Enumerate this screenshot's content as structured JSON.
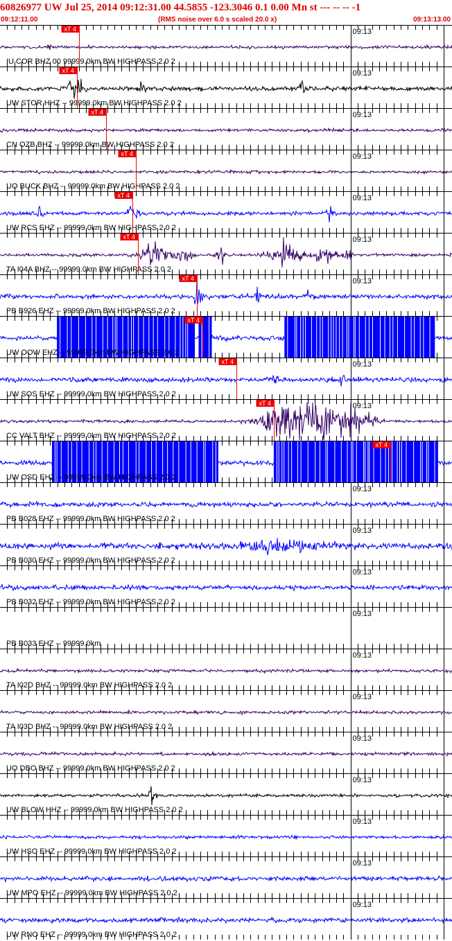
{
  "header": {
    "title": "60826977 UW Jul 25, 2014 09:12:31.00   44.5855 -123.3046  0.1 0.00 Mn st --- -- --  -1",
    "start_time": "09:12:11.00",
    "subtitle": "(RMS noise over 6.0 s scaled 20.0 x)",
    "end_time": "09:13:13.00"
  },
  "chart_data": {
    "type": "line",
    "x_range_seconds": [
      0,
      62
    ],
    "minute_tick_seconds": 49,
    "minute_tick_label": "09:13",
    "pick_label": "xT 4",
    "colors": {
      "pick": "#ee0000",
      "grid": "#000000",
      "blue": "#0000ff",
      "purple": "#330066",
      "black": "#000000"
    },
    "traces": [
      {
        "label": "IU COR BHZ 00 99999.0km BW  HIGHPASS  2.0  2",
        "color": "#330066",
        "pick_s": 11.0,
        "amp": 2,
        "events": [
          [
            6.9,
            0.2,
            5
          ]
        ]
      },
      {
        "label": "UW STOR HHZ -- 99999.0km BW  HIGHPASS  2.0  2",
        "color": "#000000",
        "pick_s": 10.8,
        "amp": 3,
        "events": [
          [
            6.8,
            0.15,
            8
          ],
          [
            10.3,
            0.4,
            14
          ],
          [
            11.3,
            0.5,
            11
          ],
          [
            19.8,
            0.3,
            7
          ],
          [
            42.0,
            0.35,
            13
          ]
        ]
      },
      {
        "label": "CN OZB BHZ -- 99999.0km BW  HIGHPASS  2.0  2",
        "color": "#330066",
        "pick_s": 14.8,
        "amp": 2,
        "events": []
      },
      {
        "label": "UO BUCK BHZ -- 99999.0km BW  HIGHPASS  2.0  2",
        "color": "#330066",
        "pick_s": 19.0,
        "amp": 2,
        "events": []
      },
      {
        "label": "UW RCS EHZ -- 99999.0km BW  HIGHPASS  2.0  2",
        "color": "#0000ff",
        "pick_s": 18.5,
        "amp": 2.5,
        "events": [
          [
            5.6,
            0.3,
            9
          ],
          [
            18.6,
            0.4,
            14
          ],
          [
            46.0,
            0.25,
            24
          ]
        ]
      },
      {
        "label": "TA I04A BHZ -- 99999.0km BW  HIGHPASS  2.0  2",
        "color": "#330066",
        "pick_s": 19.3,
        "amp": 2,
        "events": [
          [
            21.5,
            1.3,
            14
          ],
          [
            25.8,
            0.9,
            9
          ],
          [
            31.0,
            0.5,
            9
          ],
          [
            39.8,
            1.5,
            15
          ],
          [
            45.5,
            1.0,
            11
          ],
          [
            48.8,
            0.5,
            8
          ]
        ]
      },
      {
        "label": "PB B926 EHZ -- 99999.0km BW  HIGHPASS  2.0  2",
        "color": "#0000ff",
        "pick_s": 27.5,
        "amp": 3,
        "events": [
          [
            27.6,
            0.3,
            30
          ],
          [
            36.0,
            0.15,
            10
          ],
          [
            43.0,
            0.15,
            10
          ]
        ]
      },
      {
        "label": "UW OOW EHZ -- 99999.0km BW  HIGHPASS  2.0  2",
        "color": "#0000ff",
        "pick_s": 28.3,
        "amp": 3,
        "events": [],
        "saturated": [
          [
            8.0,
            27.2
          ],
          [
            27.8,
            29.6
          ],
          [
            39.8,
            60.8
          ]
        ]
      },
      {
        "label": "UW SOS EHZ -- 99999.0km BW  HIGHPASS  2.0  2",
        "color": "#0000ff",
        "pick_s": 33.0,
        "amp": 3,
        "events": [
          [
            38.5,
            0.6,
            6
          ],
          [
            48.0,
            0.6,
            6
          ]
        ]
      },
      {
        "label": "CC VALT BHZ -- 99999.0km BW  HIGHPASS  2.0  2",
        "color": "#330066",
        "pick_s": 38.3,
        "amp": 2,
        "events": [
          [
            38.0,
            1.2,
            13
          ],
          [
            43.0,
            3.0,
            30
          ],
          [
            49.0,
            2.0,
            17
          ]
        ]
      },
      {
        "label": "UW OSD EHZ -- 99999.0km BW  HIGHPASS  2.0  2",
        "color": "#0000ff",
        "pick_s": 54.5,
        "amp": 3,
        "events": [],
        "saturated": [
          [
            7.3,
            30.5
          ],
          [
            38.3,
            61.2
          ]
        ]
      },
      {
        "label": "PB B028 EHZ -- 99999.0km BW  HIGHPASS  2.0  2",
        "color": "#0000ff",
        "pick_s": null,
        "amp": 3,
        "events": []
      },
      {
        "label": "PB B030 EHZ -- 99999.0km BW  HIGHPASS  2.0  2",
        "color": "#0000ff",
        "pick_s": null,
        "amp": 4,
        "events": [
          [
            40.0,
            4.0,
            7
          ]
        ]
      },
      {
        "label": "PB B032 EHZ -- 99999.0km BW  HIGHPASS  2.0  2",
        "color": "#0000ff",
        "pick_s": null,
        "amp": 3,
        "events": []
      },
      {
        "label": "PB B033 EHZ -- 99999.0km",
        "color": "#0000ff",
        "pick_s": null,
        "amp": 0,
        "events": []
      },
      {
        "label": "TA I02D BHZ -- 99999.0km BW  HIGHPASS  2.0  2",
        "color": "#330066",
        "pick_s": null,
        "amp": 2,
        "events": []
      },
      {
        "label": "TA I03D BHZ -- 99999.0km BW  HIGHPASS  2.0  2",
        "color": "#330066",
        "pick_s": null,
        "amp": 2,
        "events": []
      },
      {
        "label": "UO DBO BHZ -- 99999.0km BW  HIGHPASS  2.0  2",
        "color": "#330066",
        "pick_s": null,
        "amp": 2,
        "events": []
      },
      {
        "label": "UW BLOW HHZ -- 99999.0km BW  HIGHPASS  2.0  2",
        "color": "#000000",
        "pick_s": null,
        "amp": 2,
        "events": [
          [
            21.2,
            0.3,
            12
          ]
        ]
      },
      {
        "label": "UW HSO EHZ -- 99999.0km BW  HIGHPASS  2.0  2",
        "color": "#0000ff",
        "pick_s": null,
        "amp": 2,
        "events": []
      },
      {
        "label": "UW MPO EHZ -- 99999.0km BW  HIGHPASS  2.0  2",
        "color": "#0000ff",
        "pick_s": null,
        "amp": 3,
        "events": []
      },
      {
        "label": "UW RNO EHZ -- 99999.0km BW  HIGHPASS  2.0  2",
        "color": "#0000ff",
        "pick_s": null,
        "amp": 3,
        "events": []
      }
    ]
  }
}
